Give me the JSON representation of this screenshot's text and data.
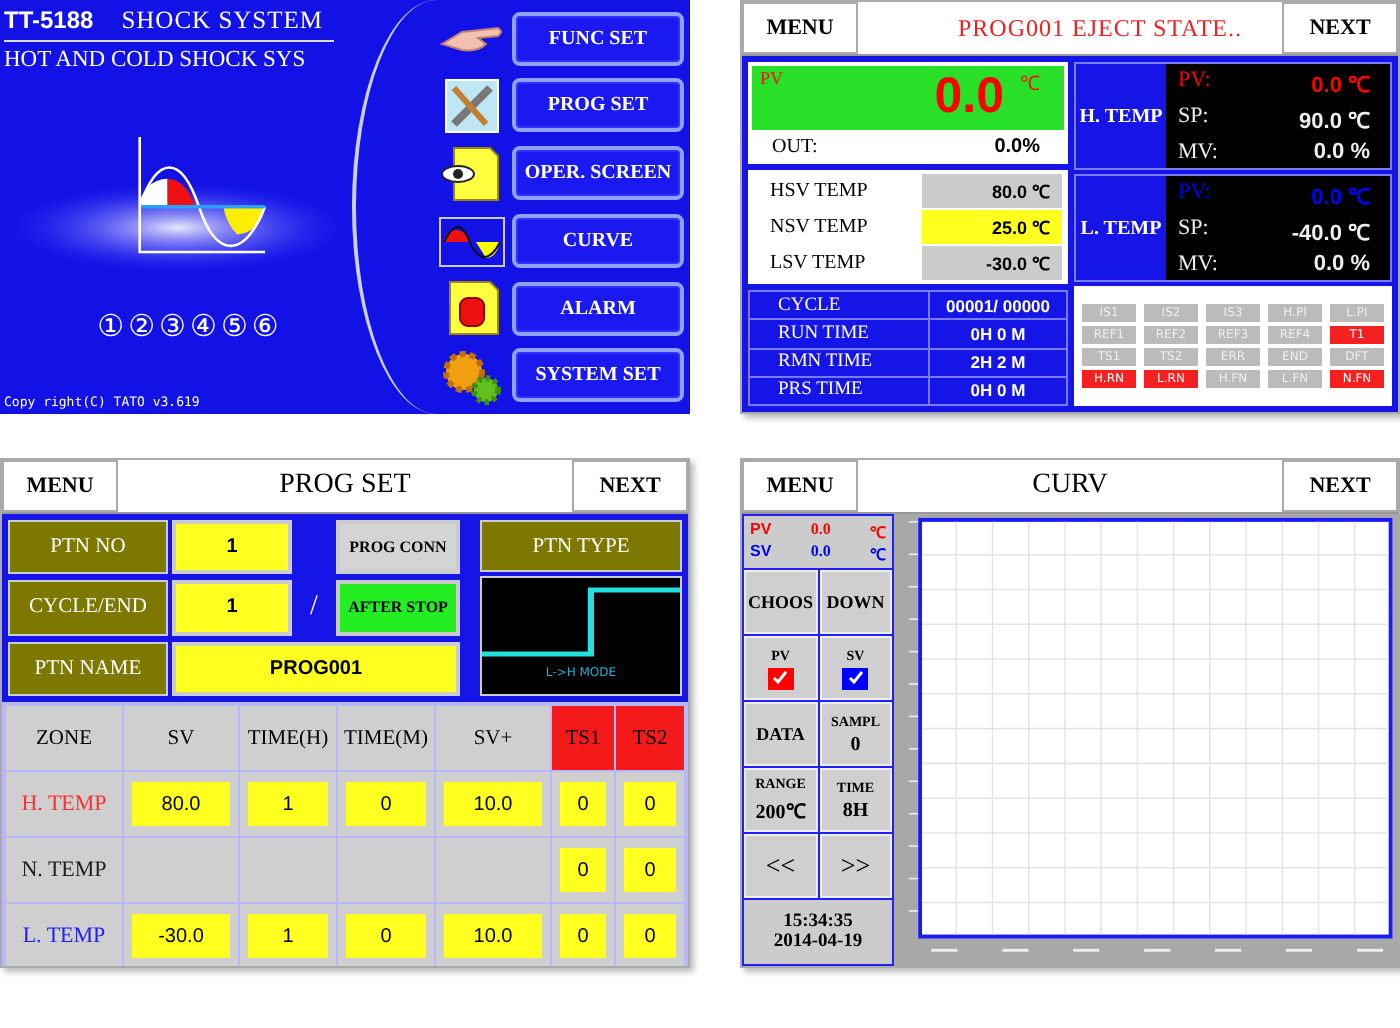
{
  "home": {
    "model": "TT-5188",
    "title": "SHOCK SYSTEM",
    "subtitle": "HOT AND COLD SHOCK SYS",
    "menu": [
      {
        "label": "FUNC SET",
        "kind": "hand"
      },
      {
        "label": "PROG SET",
        "kind": "tools"
      },
      {
        "label": "OPER. SCREEN",
        "kind": "eye"
      },
      {
        "label": "CURVE",
        "kind": "curve"
      },
      {
        "label": "ALARM",
        "kind": "alarm"
      },
      {
        "label": "SYSTEM SET",
        "kind": "gears"
      }
    ],
    "pages": [
      "①",
      "②",
      "③",
      "④",
      "⑤",
      "⑥"
    ],
    "copyright": "Copy right(C) TATO v3.619"
  },
  "status": {
    "menu": "MENU",
    "title": "PROG001 EJECT STATE..",
    "next": "NEXT",
    "pv": {
      "label": "PV",
      "value": "0.0",
      "unit": "℃",
      "out_label": "OUT:",
      "out_value": "0.0%"
    },
    "setpoints": [
      {
        "label": "HSV TEMP",
        "value": "80.0 ℃",
        "selected": false
      },
      {
        "label": "NSV TEMP",
        "value": "25.0 ℃",
        "selected": true
      },
      {
        "label": "LSV TEMP",
        "value": "-30.0 ℃",
        "selected": false
      }
    ],
    "times": [
      {
        "label": "CYCLE",
        "value": "00001/ 00000"
      },
      {
        "label": "RUN TIME",
        "value": "0H 0 M"
      },
      {
        "label": "RMN TIME",
        "value": "2H 2 M"
      },
      {
        "label": "PRS TIME",
        "value": "0H 0 M"
      }
    ],
    "zones": [
      {
        "name": "H. TEMP",
        "color": "#ff0000",
        "rows": [
          {
            "label": "PV:",
            "value": "0.0 ℃",
            "kind": "pv"
          },
          {
            "label": "SP:",
            "value": "90.0 ℃",
            "kind": "plain"
          },
          {
            "label": "MV:",
            "value": "0.0 %",
            "kind": "plain"
          }
        ]
      },
      {
        "name": "L. TEMP",
        "color": "#0000ff",
        "rows": [
          {
            "label": "PV:",
            "value": "0.0 ℃",
            "kind": "pv"
          },
          {
            "label": "SP:",
            "value": "-40.0 ℃",
            "kind": "plain"
          },
          {
            "label": "MV:",
            "value": "0.0 %",
            "kind": "plain"
          }
        ]
      }
    ],
    "indicators": [
      {
        "label": "IS1",
        "on": false
      },
      {
        "label": "IS2",
        "on": false
      },
      {
        "label": "IS3",
        "on": false
      },
      {
        "label": "H.PI",
        "on": false
      },
      {
        "label": "L.PI",
        "on": false
      },
      {
        "label": "REF1",
        "on": false
      },
      {
        "label": "REF2",
        "on": false
      },
      {
        "label": "REF3",
        "on": false
      },
      {
        "label": "REF4",
        "on": false
      },
      {
        "label": "T1",
        "on": true
      },
      {
        "label": "TS1",
        "on": false
      },
      {
        "label": "TS2",
        "on": false
      },
      {
        "label": "ERR",
        "on": false
      },
      {
        "label": "END",
        "on": false
      },
      {
        "label": "DFT",
        "on": false
      },
      {
        "label": "H.RN",
        "on": true
      },
      {
        "label": "L.RN",
        "on": true
      },
      {
        "label": "H.FN",
        "on": false
      },
      {
        "label": "L.FN",
        "on": false
      },
      {
        "label": "N.FN",
        "on": true
      }
    ]
  },
  "prog": {
    "menu": "MENU",
    "title": "PROG SET",
    "next": "NEXT",
    "ptn_no_label": "PTN NO",
    "ptn_no": "1",
    "cycle_label": "CYCLE/END",
    "cycle": "1",
    "slash": "/",
    "ptn_name_label": "PTN NAME",
    "ptn_name": "PROG001",
    "conn": "PROG CONN",
    "after_stop": "AFTER STOP",
    "ptn_type_label": "PTN TYPE",
    "ptn_mode": "L->H MODE",
    "columns": [
      {
        "label": "ZONE",
        "alarm": false
      },
      {
        "label": "SV",
        "alarm": false
      },
      {
        "label": "TIME(H)",
        "alarm": false
      },
      {
        "label": "TIME(M)",
        "alarm": false
      },
      {
        "label": "SV+",
        "alarm": false
      },
      {
        "label": "TS1",
        "alarm": true
      },
      {
        "label": "TS2",
        "alarm": true
      }
    ],
    "rows": [
      {
        "zone": "H. TEMP",
        "color": "#ff3030",
        "cells": [
          "80.0",
          "1",
          "0",
          "10.0"
        ],
        "ts": [
          "0",
          "0"
        ]
      },
      {
        "zone": "N. TEMP",
        "color": "#202020",
        "ts": [
          "0",
          "0"
        ]
      },
      {
        "zone": "L. TEMP",
        "color": "#2020ff",
        "cells": [
          "-30.0",
          "1",
          "0",
          "10.0"
        ],
        "ts": [
          "0",
          "0"
        ]
      }
    ]
  },
  "curve": {
    "menu": "MENU",
    "title": "CURV",
    "next": "NEXT",
    "readouts": [
      {
        "label": "PV",
        "value": "0.0",
        "unit": "℃",
        "color": "#ff0000"
      },
      {
        "label": "SV",
        "value": "0.0",
        "unit": "℃",
        "color": "#0000ff"
      }
    ],
    "choose": "CHOOS",
    "down": "DOWN",
    "toggles": [
      {
        "label": "PV",
        "checked": true,
        "color": "#ff0000"
      },
      {
        "label": "SV",
        "checked": true,
        "color": "#0000ff"
      }
    ],
    "data": "DATA",
    "sample_label": "SAMPL",
    "sample": "0",
    "range_label": "RANGE",
    "range": "200℃",
    "time_label": "TIME",
    "time": "8H",
    "prev": "<<",
    "fwd": ">>",
    "clock": "15:34:35",
    "date": "2014-04-19"
  }
}
